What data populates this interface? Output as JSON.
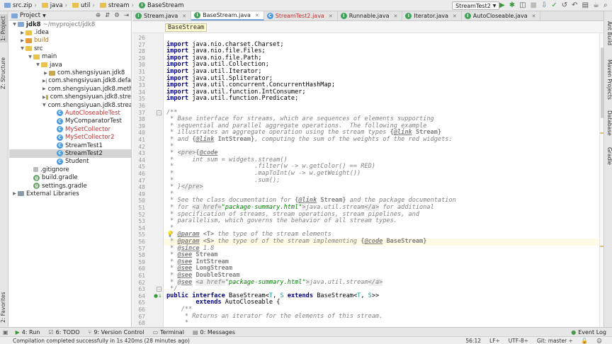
{
  "navbar": {
    "crumbs": [
      "src.zip",
      "java",
      "util",
      "stream",
      "BaseStream"
    ],
    "run_config": "StreamTest2"
  },
  "left_strip": {
    "project_tab": "1: Project",
    "structure_tab": "Z: Structure",
    "favorites_tab": "2: Favorites"
  },
  "right_strip": {
    "ant_tab": "Ant Build",
    "maven_tab": "Maven Projects",
    "database_tab": "Database",
    "gradle_tab": "Gradle"
  },
  "project_panel": {
    "title": "Project",
    "tree": [
      {
        "label": "jdk8",
        "path": "~/myproject/jdk8",
        "indent": 0,
        "arrow": "down",
        "icon": "folder-icon"
      },
      {
        "label": ".idea",
        "indent": 1,
        "arrow": "right",
        "icon": "folder-icon"
      },
      {
        "label": "build",
        "indent": 1,
        "arrow": "right",
        "icon": "folder-icon",
        "color": "orange"
      },
      {
        "label": "src",
        "indent": 1,
        "arrow": "down",
        "icon": "folder-icon"
      },
      {
        "label": "main",
        "indent": 2,
        "arrow": "down",
        "icon": "folder-icon"
      },
      {
        "label": "java",
        "indent": 3,
        "arrow": "down",
        "icon": "folder-icon"
      },
      {
        "label": "com.shengsiyuan.jdk8",
        "indent": 4,
        "arrow": "right",
        "icon": "package-icon"
      },
      {
        "label": "com.shengsiyuan.jdk8.defa",
        "indent": 4,
        "arrow": "right",
        "icon": "package-icon"
      },
      {
        "label": "com.shengsiyuan.jdk8.meth",
        "indent": 4,
        "arrow": "right",
        "icon": "package-icon"
      },
      {
        "label": "com.shengsiyuan.jdk8.stre",
        "indent": 4,
        "arrow": "right",
        "icon": "package-icon"
      },
      {
        "label": "com.shengsiyuan.jdk8.strea",
        "indent": 4,
        "arrow": "down",
        "icon": "package-icon"
      },
      {
        "label": "AutoCloseableTest",
        "indent": 5,
        "arrow": "",
        "icon": "class-icon",
        "color": "red"
      },
      {
        "label": "MyComparatorTest",
        "indent": 5,
        "arrow": "",
        "icon": "class-icon"
      },
      {
        "label": "MySetCollector",
        "indent": 5,
        "arrow": "",
        "icon": "class-icon",
        "color": "red"
      },
      {
        "label": "MySetCollector2",
        "indent": 5,
        "arrow": "",
        "icon": "class-icon",
        "color": "red"
      },
      {
        "label": "StreamTest1",
        "indent": 5,
        "arrow": "",
        "icon": "class-icon"
      },
      {
        "label": "StreamTest2",
        "indent": 5,
        "arrow": "",
        "icon": "class-icon",
        "selected": true
      },
      {
        "label": "Student",
        "indent": 5,
        "arrow": "",
        "icon": "class-icon"
      },
      {
        "label": ".gitignore",
        "indent": 2,
        "arrow": "",
        "icon": "file-icon"
      },
      {
        "label": "build.gradle",
        "indent": 2,
        "arrow": "",
        "icon": "gradle-icon"
      },
      {
        "label": "settings.gradle",
        "indent": 2,
        "arrow": "",
        "icon": "gradle-icon"
      },
      {
        "label": "External Libraries",
        "indent": 0,
        "arrow": "right",
        "icon": "library-icon"
      }
    ]
  },
  "editor": {
    "tabs": [
      {
        "label": "Stream.java",
        "active": false
      },
      {
        "label": "BaseStream.java",
        "active": true
      },
      {
        "label": "StreamTest2.java",
        "active": false,
        "color": "red"
      },
      {
        "label": "Runnable.java",
        "active": false
      },
      {
        "label": "Iterator.java",
        "active": false
      },
      {
        "label": "AutoCloseable.java",
        "active": false
      }
    ],
    "breadcrumb": "BaseStream",
    "lines": [
      {
        "n": "26",
        "html": ""
      },
      {
        "n": "27",
        "html": "<span class='kw'>import</span> java.nio.charset.Charset;"
      },
      {
        "n": "28",
        "html": "<span class='kw'>import</span> java.nio.file.Files;"
      },
      {
        "n": "29",
        "html": "<span class='kw'>import</span> java.nio.file.Path;"
      },
      {
        "n": "30",
        "html": "<span class='kw'>import</span> java.util.Collection;"
      },
      {
        "n": "31",
        "html": "<span class='kw'>import</span> java.util.Iterator;"
      },
      {
        "n": "32",
        "html": "<span class='kw'>import</span> java.util.Spliterator;"
      },
      {
        "n": "33",
        "html": "<span class='kw'>import</span> java.util.concurrent.ConcurrentHashMap;"
      },
      {
        "n": "34",
        "html": "<span class='kw'>import</span> java.util.function.IntConsumer;"
      },
      {
        "n": "35",
        "html": "<span class='kw'>import</span> java.util.function.Predicate;"
      },
      {
        "n": "36",
        "html": ""
      },
      {
        "n": "37",
        "html": "<span class='cm'>/**</span>"
      },
      {
        "n": "38",
        "html": "<span class='cm'> * Base interface for streams, which are sequences of elements supporting</span>"
      },
      {
        "n": "39",
        "html": "<span class='cm'> * sequential and parallel aggregate operations.  The following example</span>"
      },
      {
        "n": "40",
        "html": "<span class='cm'> * illustrates an aggregate operation using the stream types </span><span class='tgn'>{</span><span class='tg'>@link</span><span class='tgn'> Stream}</span>"
      },
      {
        "n": "41",
        "html": "<span class='cm'> * and </span><span class='tgn'>{</span><span class='tg'>@link</span><span class='tgn'> IntStream}</span><span class='cm'>, computing the sum of the weights of the red widgets:</span>"
      },
      {
        "n": "42",
        "html": "<span class='cm'> *</span>"
      },
      {
        "n": "43",
        "html": "<span class='cm'> * </span><span class='html'>&lt;pre&gt;</span><span class='tgn'>{</span><span class='tg'>@code</span>"
      },
      {
        "n": "44",
        "html": "<span class='cm'> *     int sum = widgets.stream()</span>"
      },
      {
        "n": "45",
        "html": "<span class='cm'> *                      .filter(w -&gt; w.getColor() == RED)</span>"
      },
      {
        "n": "46",
        "html": "<span class='cm'> *                      .mapToInt(w -&gt; w.getWeight())</span>"
      },
      {
        "n": "47",
        "html": "<span class='cm'> *                      .sum();</span>"
      },
      {
        "n": "48",
        "html": "<span class='cm'> * }</span><span class='html'>&lt;/pre&gt;</span>"
      },
      {
        "n": "49",
        "html": "<span class='cm'> *</span>"
      },
      {
        "n": "50",
        "html": "<span class='cm'> * See the class documentation for </span><span class='tgn'>{</span><span class='tg'>@link</span><span class='tgn'> Stream}</span><span class='cm'> and the package documentation</span>"
      },
      {
        "n": "51",
        "html": "<span class='cm'> * for </span><span class='html'>&lt;a href=</span><span class='htmlv'>\"package-summary.html\"</span><span class='html'>&gt;</span><span class='cm'>java.util.stream</span><span class='html'>&lt;/a&gt;</span><span class='cm'> for additional</span>"
      },
      {
        "n": "52",
        "html": "<span class='cm'> * specification of streams, stream operations, stream pipelines, and</span>"
      },
      {
        "n": "53",
        "html": "<span class='cm'> * parallelism, which governs the behavior of all stream types.</span>"
      },
      {
        "n": "54",
        "html": "<span class='cm'> *</span>"
      },
      {
        "n": "55",
        "html": "<span class='cm'> * </span><span class='tg'>@param</span><span class='tgn'> &lt;T&gt;</span><span class='cm'> the type of the stream elements</span>"
      },
      {
        "n": "56",
        "html": "<span class='cm'> * </span><span class='tg'>@param</span><span class='tgn'> &lt;S&gt;</span><span class='cm'> the type of of the stream implementing </span><span class='tgn'>{</span><span class='tg'>@code</span><span class='tgn'> BaseStream}</span>",
        "highlight": true
      },
      {
        "n": "57",
        "html": "<span class='cm'> * </span><span class='tg'>@since</span><span class='cm'> 1.8</span>"
      },
      {
        "n": "58",
        "html": "<span class='cm'> * </span><span class='tg'>@see</span><span class='tgn'> Stream</span>"
      },
      {
        "n": "59",
        "html": "<span class='cm'> * </span><span class='tg'>@see</span><span class='tgn'> IntStream</span>"
      },
      {
        "n": "60",
        "html": "<span class='cm'> * </span><span class='tg'>@see</span><span class='tgn'> LongStream</span>"
      },
      {
        "n": "61",
        "html": "<span class='cm'> * </span><span class='tg'>@see</span><span class='tgn'> DoubleStream</span>"
      },
      {
        "n": "62",
        "html": "<span class='cm'> * </span><span class='tg'>@see</span><span class='cm'> </span><span class='html'>&lt;a href=</span><span class='htmlv'>\"package-summary.html\"</span><span class='html'>&gt;</span><span class='cm'>java.util.stream</span><span class='html'>&lt;/a&gt;</span>"
      },
      {
        "n": "63",
        "html": "<span class='cm'> */</span>"
      },
      {
        "n": "64",
        "html": "<span class='kw'>public interface</span> BaseStream&lt;<span class='gen'>T</span>, <span class='gen'>S</span> <span class='kw'>extends</span> BaseStream&lt;<span class='gen'>T</span>, <span class='gen'>S</span>&gt;&gt;"
      },
      {
        "n": "65",
        "html": "        <span class='kw'>extends</span> AutoCloseable {"
      },
      {
        "n": "66",
        "html": "    <span class='cm'>/**</span>"
      },
      {
        "n": "67",
        "html": "<span class='cm'>     * Returns an iterator for the elements of this stream.</span>"
      },
      {
        "n": "68",
        "html": "<span class='cm'>     *</span>"
      }
    ]
  },
  "bottom_tools": [
    {
      "label": "4: Run",
      "underline": "4",
      "icon": "run-icon"
    },
    {
      "label": "6: TODO",
      "underline": "6",
      "icon": "todo-icon"
    },
    {
      "label": "9: Version Control",
      "underline": "9",
      "icon": "vcs-icon"
    },
    {
      "label": "Terminal",
      "icon": "terminal-icon"
    },
    {
      "label": "0: Messages",
      "underline": "0",
      "icon": "messages-icon"
    }
  ],
  "event_log": "Event Log",
  "status": {
    "message": "Compilation completed successfully in 1s 420ms (28 minutes ago)",
    "position": "56:12",
    "line_sep": "LF÷",
    "encoding": "UTF-8÷",
    "git": "Git: master ÷"
  }
}
